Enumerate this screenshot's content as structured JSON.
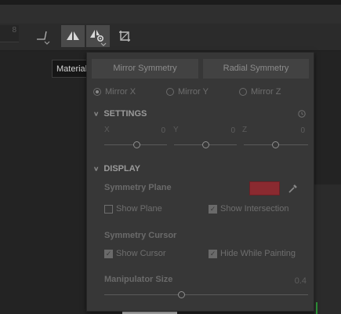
{
  "toolbar": {
    "number_field": "8",
    "buttons": [
      {
        "name": "curve-tool-icon",
        "active": false
      },
      {
        "name": "symmetry-icon",
        "active": true
      },
      {
        "name": "symmetry-settings-icon",
        "active": true
      },
      {
        "name": "transform-icon",
        "active": false
      }
    ]
  },
  "material_field": {
    "value": "Material"
  },
  "symmetry_panel": {
    "tabs": [
      {
        "label": "Mirror Symmetry",
        "selected": true
      },
      {
        "label": "Radial Symmetry",
        "selected": false
      }
    ],
    "mirror_options": [
      {
        "label": "Mirror X",
        "checked": true
      },
      {
        "label": "Mirror Y",
        "checked": false
      },
      {
        "label": "Mirror Z",
        "checked": false
      }
    ],
    "settings": {
      "title": "SETTINGS",
      "x": {
        "label": "X",
        "value": "0"
      },
      "y": {
        "label": "Y",
        "value": "0"
      },
      "z": {
        "label": "Z",
        "value": "0"
      }
    },
    "display": {
      "title": "DISPLAY",
      "symmetry_plane": {
        "label": "Symmetry Plane",
        "color": "#8a2a30",
        "show_plane": {
          "label": "Show Plane",
          "checked": false
        },
        "show_intersection": {
          "label": "Show Intersection",
          "checked": true
        }
      },
      "symmetry_cursor": {
        "label": "Symmetry Cursor",
        "show_cursor": {
          "label": "Show Cursor",
          "checked": true
        },
        "hide_while_painting": {
          "label": "Hide While Painting",
          "checked": true
        }
      },
      "manipulator_size": {
        "label": "Manipulator Size",
        "value": "0.4"
      }
    }
  },
  "colors": {
    "panel_bg": "#373737",
    "toolbar_bg": "#2b2b2b",
    "accent_green": "#2f9a3a"
  }
}
